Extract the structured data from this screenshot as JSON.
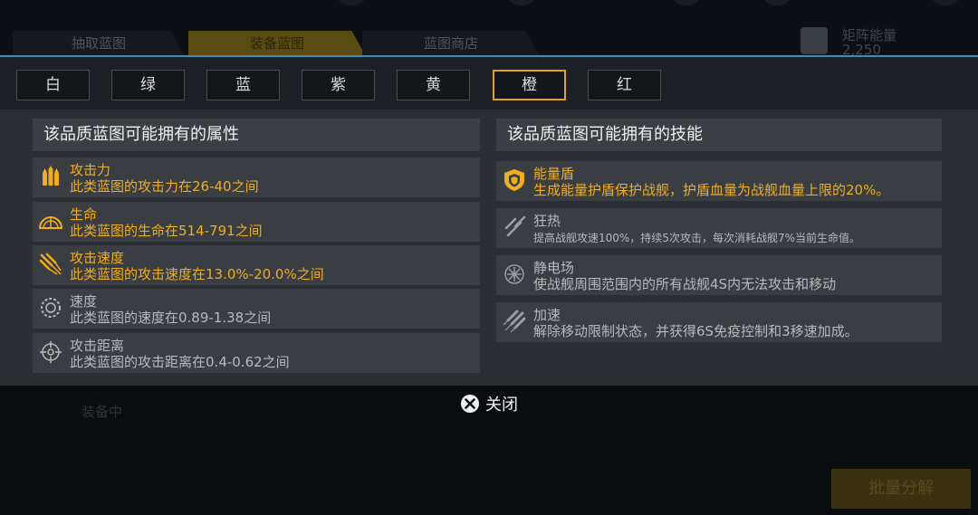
{
  "background": {
    "tabs": [
      "抽取蓝图",
      "装备蓝图",
      "蓝图商店"
    ],
    "energy_label": "矩阵能量",
    "energy_value": "2,250",
    "equipping_label": "装备中",
    "batch_button": "批量分解"
  },
  "quality_tabs": [
    "白",
    "绿",
    "蓝",
    "紫",
    "黄",
    "橙",
    "红"
  ],
  "selected_quality": "橙",
  "attributes": {
    "title": "该品质蓝图可能拥有的属性",
    "items": [
      {
        "name": "攻击力",
        "desc": "此类蓝图的攻击力在26-40之间",
        "icon": "ammo-icon",
        "highlight": true
      },
      {
        "name": "生命",
        "desc": "此类蓝图的生命在514-791之间",
        "icon": "shield-dome-icon",
        "highlight": true
      },
      {
        "name": "攻击速度",
        "desc": "此类蓝图的攻击速度在13.0%-20.0%之间",
        "icon": "missile-burst-icon",
        "highlight": true
      },
      {
        "name": "速度",
        "desc": "此类蓝图的速度在0.89-1.38之间",
        "icon": "speed-gauge-icon",
        "highlight": false
      },
      {
        "name": "攻击距离",
        "desc": "此类蓝图的攻击距离在0.4-0.62之间",
        "icon": "crosshair-icon",
        "highlight": false
      }
    ]
  },
  "skills": {
    "title": "该品质蓝图可能拥有的技能",
    "items": [
      {
        "name": "能量盾",
        "desc": "生成能量护盾保护战舰，护盾血量为战舰血量上限的20%。",
        "icon": "energy-shield-icon",
        "highlight": true,
        "small": false
      },
      {
        "name": "狂热",
        "desc": "提高战舰攻速100%，持续5次攻击，每次消耗战舰7%当前生命值。",
        "icon": "frenzy-icon",
        "highlight": false,
        "small": true
      },
      {
        "name": "静电场",
        "desc": "使战舰周围范围内的所有战舰4S内无法攻击和移动",
        "icon": "static-field-icon",
        "highlight": false,
        "small": false
      },
      {
        "name": "加速",
        "desc": "解除移动限制状态，并获得6S免疫控制和3移速加成。",
        "icon": "boost-icon",
        "highlight": false,
        "small": false
      }
    ]
  },
  "close_label": "关闭",
  "colors": {
    "accent": "#f0ad1f",
    "selected_border": "#e0a419",
    "divider": "#3a8fb8"
  }
}
